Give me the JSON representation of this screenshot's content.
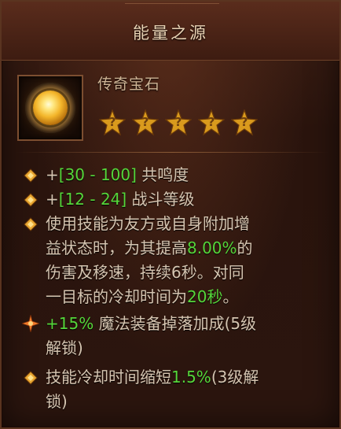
{
  "title": "能量之源",
  "gem_type": "传奇宝石",
  "rank_stars": [
    "?",
    "?",
    "?",
    "?",
    "?"
  ],
  "colors": {
    "highlight": "#55d63a",
    "text": "#d6c5b1",
    "title": "#e9d3b4"
  },
  "icons": {
    "gem": "legendary-gem-icon",
    "bullet": "diamond-bullet-icon",
    "special_bullet": "starburst-bullet-icon"
  },
  "props": [
    {
      "prefix": "+",
      "value": "[30 - 100]",
      "suffix": " 共鸣度"
    },
    {
      "prefix": "+",
      "value": "[12 - 24]",
      "suffix": " 战斗等级"
    }
  ],
  "effect": {
    "line1": "使用技能为友方或自身附加增",
    "line2_a": "益状态时，为其提高",
    "line2_value": "8.00%",
    "line2_b": "的",
    "line3": "伤害及移速，持续6秒。对同",
    "line4_a": "一目标的冷却时间为",
    "line4_value": "20秒",
    "line4_b": "。"
  },
  "unlock1": {
    "value": "+15%",
    "text_a": " 魔法装备掉落加成(5级",
    "text_b": "解锁)"
  },
  "unlock2": {
    "text_a": "技能冷却时间缩短",
    "value": "1.5%",
    "text_b": "(3级解",
    "text_c": "锁)"
  }
}
